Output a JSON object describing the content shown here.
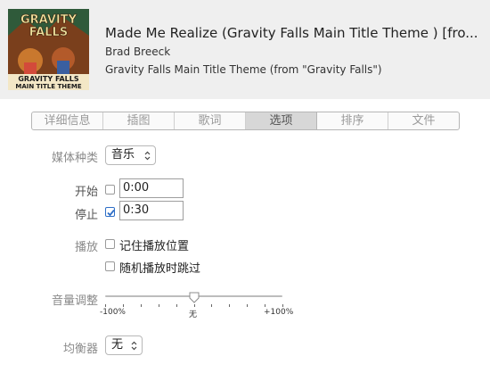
{
  "song": {
    "title": "Made Me Realize (Gravity Falls Main Title Theme ) [fro...",
    "artist": "Brad Breeck",
    "album": "Gravity Falls Main Title Theme (from \"Gravity Falls\")",
    "artwork_text": {
      "line1": "GRAVITY",
      "line2": "FALLS",
      "line3": "GRAVITY FALLS",
      "line4": "MAIN TITLE THEME"
    }
  },
  "tabs": [
    {
      "label": "详细信息",
      "active": false
    },
    {
      "label": "插图",
      "active": false
    },
    {
      "label": "歌词",
      "active": false
    },
    {
      "label": "选项",
      "active": true
    },
    {
      "label": "排序",
      "active": false
    },
    {
      "label": "文件",
      "active": false
    }
  ],
  "options": {
    "media_kind_label": "媒体种类",
    "media_kind_value": "音乐",
    "start_label": "开始",
    "start_checked": false,
    "start_value": "0:00",
    "stop_label": "停止",
    "stop_checked": true,
    "stop_value": "0:30",
    "playback_label": "播放",
    "remember_position_label": "记住播放位置",
    "remember_position_checked": false,
    "skip_shuffle_label": "随机播放时跳过",
    "skip_shuffle_checked": false,
    "volume_label": "音量调整",
    "volume_min_label": "-100%",
    "volume_mid_label": "无",
    "volume_max_label": "+100%",
    "volume_value_percent": 0,
    "eq_label": "均衡器",
    "eq_value": "无"
  },
  "icons": {
    "checkmark": "checkmark-icon",
    "select_arrows": "up-down-chevron-icon"
  },
  "colors": {
    "header_bg": "#efefef",
    "active_tab_bg": "#d7d7d7",
    "checkbox_accent": "#2f6fc7"
  }
}
